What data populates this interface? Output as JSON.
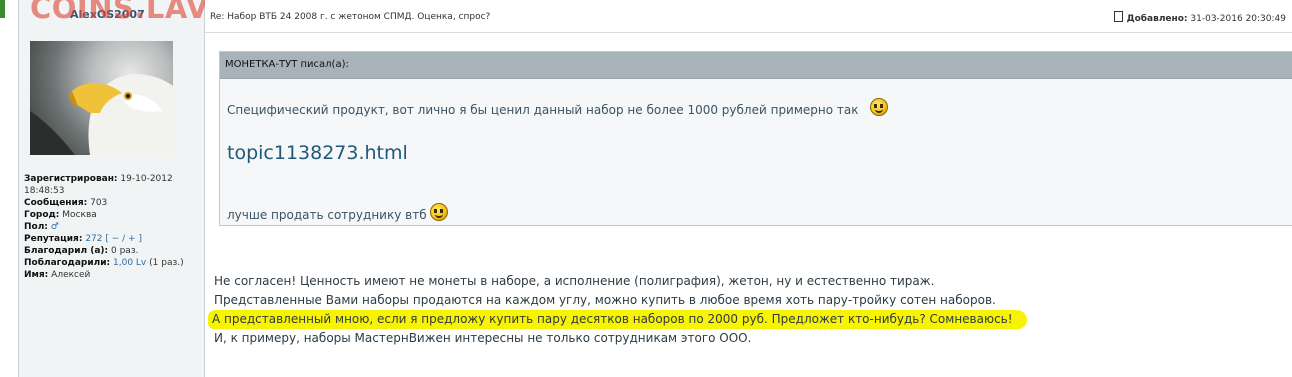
{
  "watermark": "COINS.LAVE.RU",
  "post": {
    "author": "AlexOS2007",
    "subject": "Re: Набор ВТБ 24 2008 г. с жетоном СПМД. Оценка, спрос?",
    "added_label": "Добавлено:",
    "added_date": "31-03-2016 20:30:49"
  },
  "profile": {
    "registered_label": "Зарегистрирован:",
    "registered_value": "19-10-2012 18:48:53",
    "messages_label": "Сообщения:",
    "messages_value": "703",
    "city_label": "Город:",
    "city_value": "Москва",
    "gender_label": "Пол:",
    "gender_symbol": "♂",
    "reputation_label": "Репутация:",
    "reputation_value": "272",
    "reputation_controls": "[ − / + ]",
    "thanked_label": "Благодарил (а):",
    "thanked_value": "0 раз.",
    "was_thanked_label": "Поблагодарили:",
    "was_thanked_value": "1,00 Lv",
    "was_thanked_count": "(1 раз.)",
    "name_label": "Имя:",
    "name_value": "Алексей"
  },
  "quote": {
    "author": "МОНЕТКА-ТУТ писал(а):",
    "line1": "Специфический продукт, вот лично я бы ценил данный набор не более 1000 рублей примерно так",
    "link": "topic1138273.html",
    "line2": "лучше продать сотруднику втб"
  },
  "reply": {
    "line1": "Не согласен! Ценность имеют не монеты в наборе, а исполнение (полиграфия), жетон, ну и естественно тираж.",
    "line2": "Представленные Вами наборы продаются на каждом углу, можно купить в любое время хоть пару-тройку сотен наборов.",
    "line3": "А представленный мною, если я предложу купить пару десятков наборов по 2000 руб. Предложет кто-нибудь? Сомневаюсь!",
    "line4": "И, к примеру, наборы МастернВижен интересны не только сотрудникам этого ООО."
  },
  "colors": {
    "highlight": "#f8f400",
    "quote_header": "#a8b3b9",
    "link": "#21587a"
  }
}
